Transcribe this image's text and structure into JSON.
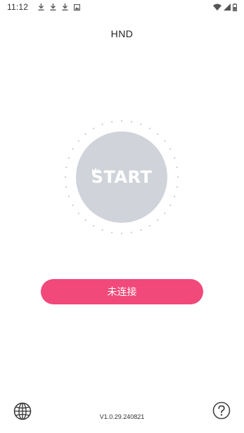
{
  "status_bar": {
    "time": "11:12",
    "left_icons": [
      "download-icon",
      "download-icon",
      "download-icon",
      "image-notification-icon"
    ],
    "right_icons": [
      "wifi-icon",
      "signal-icon",
      "battery-icon"
    ]
  },
  "header": {
    "title": "HND"
  },
  "start_button": {
    "label": "START",
    "decoration": "crown-icon"
  },
  "connect_button": {
    "label": "未连接"
  },
  "footer": {
    "language_icon": "globe-icon",
    "help_icon": "question-icon",
    "version": "V1.0.29.240821"
  },
  "colors": {
    "accent": "#f0497a",
    "start_circle": "#d0d3da",
    "dots": "#c8cbd2"
  }
}
